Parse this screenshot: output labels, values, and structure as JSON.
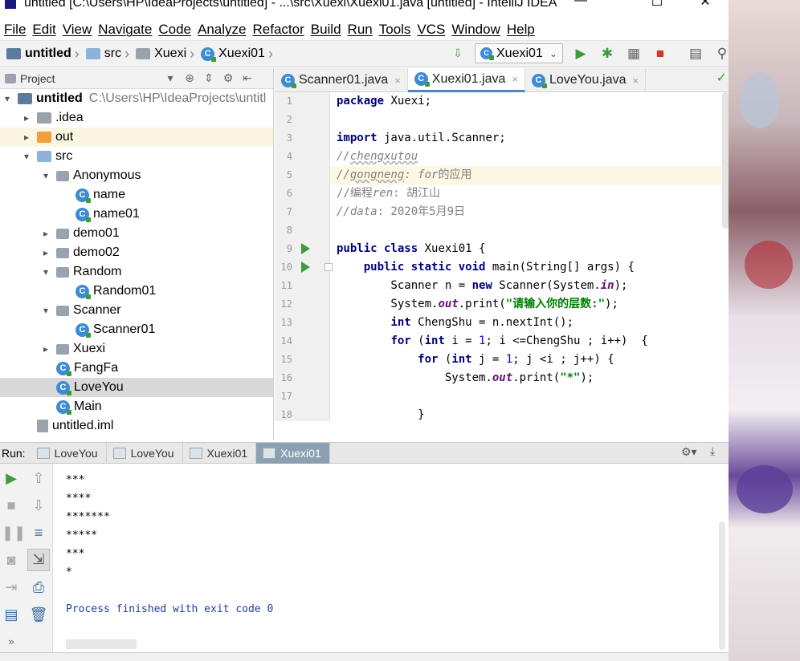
{
  "window": {
    "title": "untitled [C:\\Users\\HP\\IdeaProjects\\untitled] - ...\\src\\Xuexi\\Xuexi01.java [untitled] - IntelliJ IDEA",
    "minimize": "—",
    "maximize": "☐",
    "close": "✕"
  },
  "menu": [
    "File",
    "Edit",
    "View",
    "Navigate",
    "Code",
    "Analyze",
    "Refactor",
    "Build",
    "Run",
    "Tools",
    "VCS",
    "Window",
    "Help"
  ],
  "breadcrumb": [
    "untitled",
    "src",
    "Xuexi",
    "Xuexi01"
  ],
  "toolbar": {
    "run_config": "Xuexi01"
  },
  "project_panel": {
    "title": "Project",
    "tree": [
      {
        "label": "untitled",
        "extra": "C:\\Users\\HP\\IdeaProjects\\untitl",
        "icon": "module-folder",
        "arrow": "▾",
        "indent": 0,
        "bold": true
      },
      {
        "label": ".idea",
        "icon": "folder",
        "arrow": "▸",
        "indent": 1
      },
      {
        "label": "out",
        "icon": "orange-folder",
        "arrow": "▸",
        "indent": 1,
        "highlight": "light"
      },
      {
        "label": "src",
        "icon": "blue-folder",
        "arrow": "▾",
        "indent": 1
      },
      {
        "label": "Anonymous",
        "icon": "package",
        "arrow": "▾",
        "indent": 2
      },
      {
        "label": "name",
        "icon": "class",
        "arrow": "",
        "indent": 3
      },
      {
        "label": "name01",
        "icon": "class",
        "arrow": "",
        "indent": 3
      },
      {
        "label": "demo01",
        "icon": "package",
        "arrow": "▸",
        "indent": 2
      },
      {
        "label": "demo02",
        "icon": "package",
        "arrow": "▸",
        "indent": 2
      },
      {
        "label": "Random",
        "icon": "package",
        "arrow": "▾",
        "indent": 2
      },
      {
        "label": "Random01",
        "icon": "class",
        "arrow": "",
        "indent": 3
      },
      {
        "label": "Scanner",
        "icon": "package",
        "arrow": "▾",
        "indent": 2
      },
      {
        "label": "Scanner01",
        "icon": "class",
        "arrow": "",
        "indent": 3
      },
      {
        "label": "Xuexi",
        "icon": "package",
        "arrow": "▸",
        "indent": 2
      },
      {
        "label": "FangFa",
        "icon": "class",
        "arrow": "",
        "indent": 2
      },
      {
        "label": "LoveYou",
        "icon": "class",
        "arrow": "",
        "indent": 2,
        "highlight": "selected"
      },
      {
        "label": "Main",
        "icon": "class",
        "arrow": "",
        "indent": 2
      },
      {
        "label": "untitled.iml",
        "icon": "iml",
        "arrow": "",
        "indent": 1
      }
    ]
  },
  "editor": {
    "tabs": [
      {
        "label": "Scanner01.java",
        "active": false
      },
      {
        "label": "Xuexi01.java",
        "active": true
      },
      {
        "label": "LoveYou.java",
        "active": false
      }
    ],
    "tab_close": "×",
    "line_numbers": [
      "1",
      "2",
      "3",
      "4",
      "5",
      "6",
      "7",
      "8",
      "9",
      "10",
      "11",
      "12",
      "13",
      "14",
      "15",
      "16",
      "17",
      "18"
    ]
  },
  "run_panel": {
    "label": "Run:",
    "tabs": [
      {
        "label": "LoveYou",
        "active": false
      },
      {
        "label": "LoveYou",
        "active": false
      },
      {
        "label": "Xuexi01",
        "active": false
      },
      {
        "label": "Xuexi01",
        "active": true
      }
    ],
    "output": [
      "***",
      "****",
      "*******",
      "*****",
      "***",
      "*"
    ],
    "finished": "Process finished with exit code 0"
  },
  "colors": {
    "keyword": "#000080",
    "string": "#008000",
    "comment": "#808080",
    "number": "#0000ff",
    "accent": "#4a88c7",
    "run_green": "#3c9c3c"
  }
}
